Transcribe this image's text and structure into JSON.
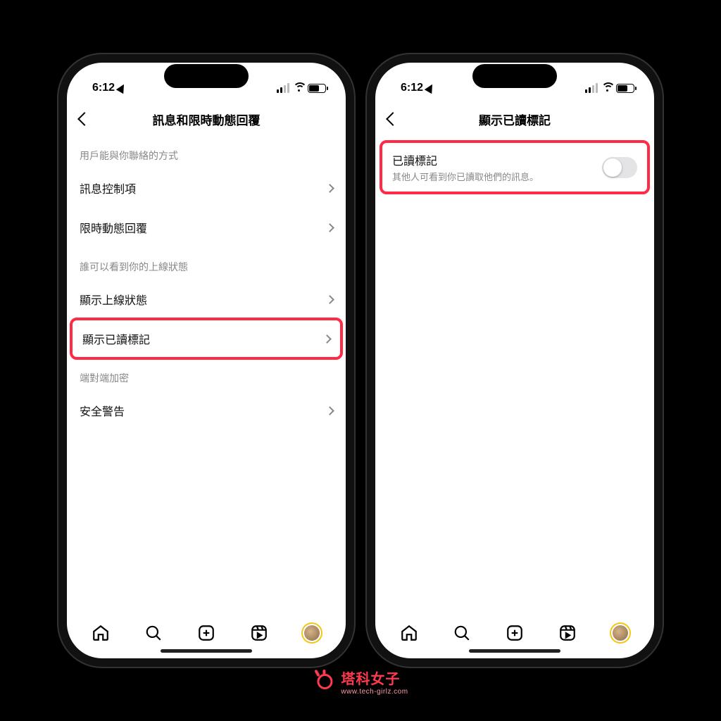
{
  "status": {
    "time": "6:12"
  },
  "left": {
    "title": "訊息和限時動態回覆",
    "section1": "用戶能與你聯絡的方式",
    "row_messages": "訊息控制項",
    "row_story_replies": "限時動態回覆",
    "section2": "誰可以看到你的上線狀態",
    "row_activity_status": "顯示上線狀態",
    "row_read_receipts": "顯示已讀標記",
    "section3": "端對端加密",
    "row_security": "安全警告"
  },
  "right": {
    "title": "顯示已讀標記",
    "toggle_title": "已讀標記",
    "toggle_sub": "其他人可看到你已讀取他們的訊息。"
  },
  "watermark": {
    "title": "塔科女子",
    "url": "www.tech-girlz.com"
  }
}
